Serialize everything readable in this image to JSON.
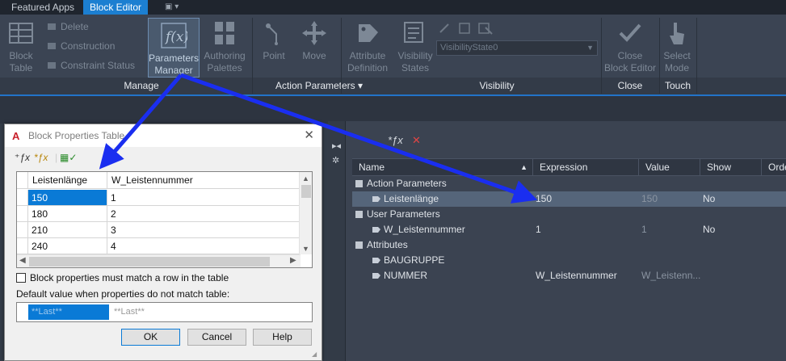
{
  "ribbon": {
    "tabs": [
      {
        "label": "Featured Apps"
      },
      {
        "label": "Block Editor"
      },
      {
        "label": "▣ ▾"
      }
    ],
    "manage": {
      "block_table": "Block\nTable",
      "delete": "Delete",
      "construction": "Construction",
      "constraint_status": "Constraint Status",
      "parameters_manager": "Parameters\nManager",
      "authoring_palettes": "Authoring\nPalettes",
      "group_label": "Manage"
    },
    "action_parameters": {
      "point": "Point",
      "move": "Move",
      "group_label": "Action Parameters ▾"
    },
    "visibility": {
      "attribute_definition": "Attribute\nDefinition",
      "visibility_states": "Visibility\nStates",
      "state_combo": "VisibilityState0",
      "group_label": "Visibility"
    },
    "close": {
      "close_block_editor": "Close\nBlock Editor",
      "group_label": "Close"
    },
    "touch": {
      "select_mode": "Select\nMode",
      "group_label": "Touch"
    }
  },
  "parameters_manager": {
    "columns": [
      "Name",
      "Expression",
      "Value",
      "Show",
      "Orde"
    ],
    "rows": [
      {
        "kind": "group",
        "name": "Action Parameters"
      },
      {
        "kind": "item",
        "name": "Leistenlänge",
        "expression": "150",
        "value": "150",
        "show": "No",
        "highlight": true,
        "icon": "linear-parameter-icon"
      },
      {
        "kind": "group",
        "name": "User Parameters"
      },
      {
        "kind": "item",
        "name": "W_Leistennummer",
        "expression": "1",
        "value": "1",
        "show": "No",
        "icon": "user-parameter-icon"
      },
      {
        "kind": "group",
        "name": "Attributes"
      },
      {
        "kind": "item",
        "name": "BAUGRUPPE",
        "expression": "",
        "value": "",
        "show": "",
        "icon": "attribute-tag-icon"
      },
      {
        "kind": "item",
        "name": "NUMMER",
        "expression": "W_Leistennummer",
        "value": "W_Leistenn...",
        "show": "",
        "icon": "attribute-tag-icon"
      }
    ]
  },
  "dialog": {
    "title": "Block Properties Table",
    "logo": "A",
    "close": "✕",
    "columns": [
      "Leistenlänge",
      "W_Leistennummer"
    ],
    "rows": [
      [
        "150",
        "1"
      ],
      [
        "180",
        "2"
      ],
      [
        "210",
        "3"
      ],
      [
        "240",
        "4"
      ]
    ],
    "must_match_label": "Block properties must match a row in the table",
    "default_label": "Default value when properties do not match table:",
    "default_values": [
      "**Last**",
      "**Last**"
    ],
    "ok": "OK",
    "cancel": "Cancel",
    "help": "Help"
  },
  "colors": {
    "accent": "#1c7fd1",
    "arrow": "#1a2ef0",
    "selection": "#0a7ad6"
  }
}
